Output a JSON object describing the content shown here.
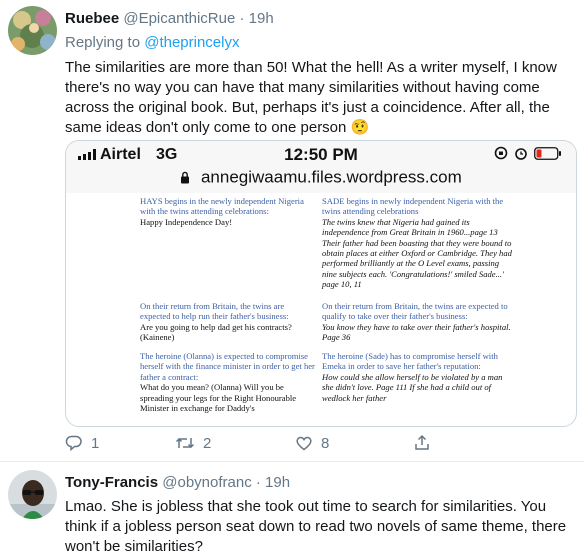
{
  "tweet1": {
    "name": "Ruebee",
    "handle": "@EpicanthicRue",
    "time": "19h",
    "replying_prefix": "Replying to",
    "replying_to": "@theprincelyx",
    "text": "The similarities are more than 50! What the hell! As a writer myself, I know there's no way you can have that many similarities without having come across the original book. But, perhaps it's just a coincidence. After all, the same ideas don't only come to one person 🤨",
    "media": {
      "carrier": "Airtel",
      "network": "3G",
      "clock": "12:50 PM",
      "url": "annegiwaamu.files.wordpress.com",
      "left_col": [
        {
          "blue": "HAYS begins in the newly independent Nigeria with the twins attending celebrations:",
          "black": "Happy Independence Day!"
        },
        {
          "blue": "On their return from Britain, the twins are expected to help run their father's business:",
          "black": "Are you going to help dad get his contracts? (Kainene)"
        },
        {
          "blue": "The heroine (Olanna) is expected to compromise herself with the finance minister in order to get her father a contract:",
          "black": "What do you mean? (Olanna) Will you be spreading your legs for the Right Honourable Minister in exchange for Daddy's"
        }
      ],
      "right_col": [
        {
          "blue": "SADE begins in newly independent Nigeria with the twins attending celebrations",
          "ital": "The twins knew that Nigeria had gained its independence from Great Britain in 1960...page 13 Their father had been boasting that they were bound to obtain places at either Oxford or Cambridge. They had performed brilliantly at the O Level exams, passing nine subjects each. 'Congratulations!' smiled Sade...' page 10, 11"
        },
        {
          "blue": "On their return from Britain, the twins are expected to qualify to take over their father's business:",
          "ital": "You know they have to take over their father's hospital. Page 36"
        },
        {
          "blue": "The heroine (Sade) has to compromise herself with Emeka in order to save her father's reputation:",
          "ital": "How could she allow herself to be violated by a man she didn't love. Page 111 If she had a child out of wedlock her father"
        }
      ]
    },
    "replies": "1",
    "retweets": "2",
    "likes": "8"
  },
  "tweet2": {
    "name": "Tony-Francis",
    "handle": "@obynofranc",
    "time": "19h",
    "text": "Lmao. She is jobless that she took out time to search for similarities. You think if a jobless person seat down to read two novels of same theme, there won't be similarities?"
  },
  "colors": {
    "text": "#14171a",
    "secondary": "#657786",
    "link": "#1da1f2",
    "border": "#e6ecf0"
  }
}
